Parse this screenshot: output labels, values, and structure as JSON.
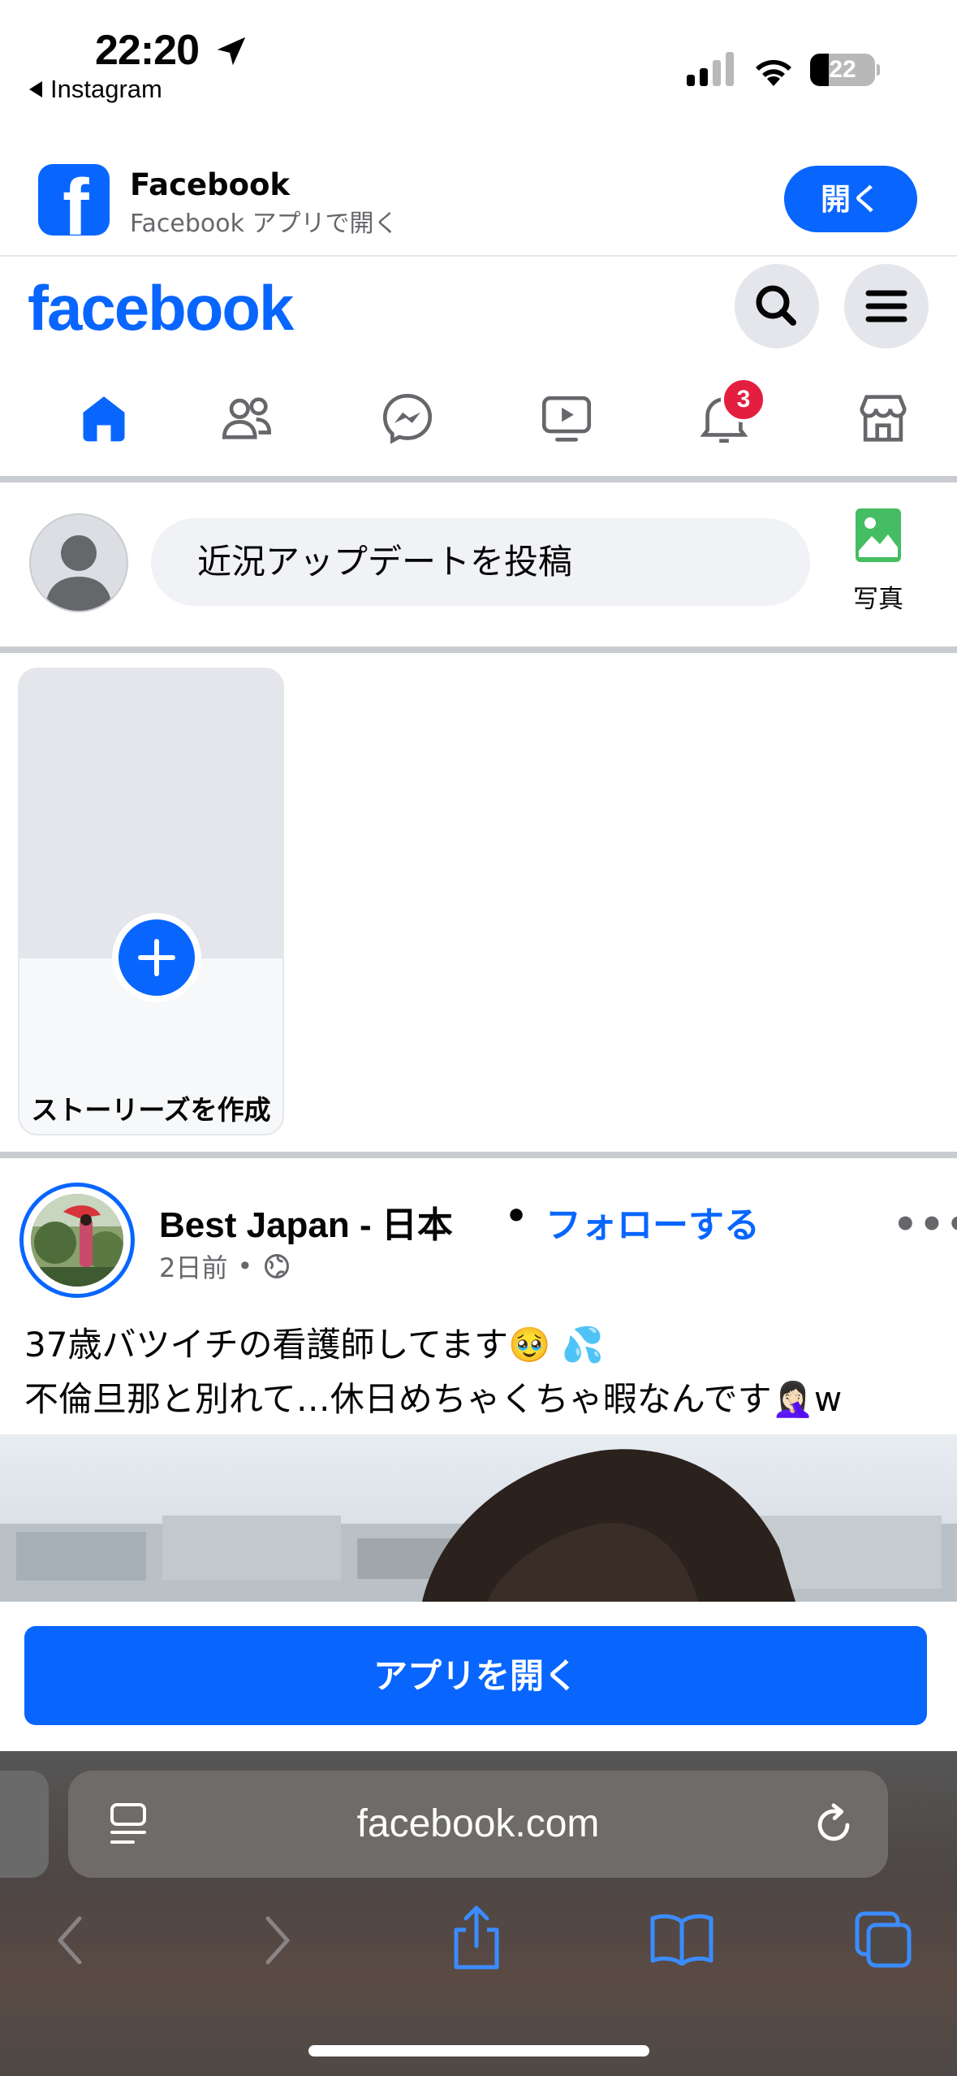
{
  "status_bar": {
    "time": "22:20",
    "back_app": "Instagram",
    "battery": "22"
  },
  "app_banner": {
    "title": "Facebook",
    "subtitle": "Facebook アプリで開く",
    "open_label": "開く"
  },
  "header": {
    "logo": "facebook"
  },
  "nav": {
    "notification_count": "3"
  },
  "composer": {
    "placeholder": "近況アップデートを投稿",
    "photo_label": "写真"
  },
  "stories": {
    "create_label": "ストーリーズを作成"
  },
  "post": {
    "page_name": "Best Japan - 日本",
    "separator": "•",
    "follow_label": "フォローする",
    "time": "2日前",
    "time_separator": "•",
    "text_line1": "37歳バツイチの看護師してます🥹 💦",
    "text_line2": "不倫旦那と別れて…休日めちゃくちゃ暇なんです🤦🏻‍♀️w"
  },
  "open_app_button": "アプリを開く",
  "safari": {
    "url": "facebook.com"
  },
  "colors": {
    "accent": "#0866ff",
    "badge": "#e41e3f"
  }
}
